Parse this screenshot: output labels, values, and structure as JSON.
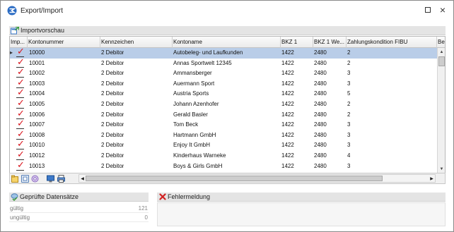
{
  "window": {
    "title": "Export/Import",
    "maximize_icon": "maximize-icon",
    "close_label": "×"
  },
  "preview": {
    "section_label": "Importvorschau",
    "columns": [
      "Imp...",
      "Kontonummer",
      "Kennzeichen",
      "Kontoname",
      "BKZ 1",
      "BKZ 1 We...",
      "Zahlungskondition FIBU",
      "Bele"
    ],
    "rows": [
      {
        "kontonummer": "10000",
        "kennzeichen": "2  Debitor",
        "kontoname": "Autobeleg- und Laufkunden",
        "bkz1": "1422",
        "bkz1we": "2480",
        "zahlung": "2",
        "selected": true
      },
      {
        "kontonummer": "10001",
        "kennzeichen": "2  Debitor",
        "kontoname": "Annas Sportwelt 12345",
        "bkz1": "1422",
        "bkz1we": "2480",
        "zahlung": "2",
        "selected": false
      },
      {
        "kontonummer": "10002",
        "kennzeichen": "2  Debitor",
        "kontoname": "Ammansberger",
        "bkz1": "1422",
        "bkz1we": "2480",
        "zahlung": "3",
        "selected": false
      },
      {
        "kontonummer": "10003",
        "kennzeichen": "2  Debitor",
        "kontoname": "Auermann Sport",
        "bkz1": "1422",
        "bkz1we": "2480",
        "zahlung": "3",
        "selected": false
      },
      {
        "kontonummer": "10004",
        "kennzeichen": "2  Debitor",
        "kontoname": "Austria Sports",
        "bkz1": "1422",
        "bkz1we": "2480",
        "zahlung": "5",
        "selected": false
      },
      {
        "kontonummer": "10005",
        "kennzeichen": "2  Debitor",
        "kontoname": "Johann Azenhofer",
        "bkz1": "1422",
        "bkz1we": "2480",
        "zahlung": "2",
        "selected": false
      },
      {
        "kontonummer": "10006",
        "kennzeichen": "2  Debitor",
        "kontoname": "Gerald Basler",
        "bkz1": "1422",
        "bkz1we": "2480",
        "zahlung": "2",
        "selected": false
      },
      {
        "kontonummer": "10007",
        "kennzeichen": "2  Debitor",
        "kontoname": "Tom Beck",
        "bkz1": "1422",
        "bkz1we": "2480",
        "zahlung": "3",
        "selected": false
      },
      {
        "kontonummer": "10008",
        "kennzeichen": "2  Debitor",
        "kontoname": "Hartmann GmbH",
        "bkz1": "1422",
        "bkz1we": "2480",
        "zahlung": "3",
        "selected": false
      },
      {
        "kontonummer": "10010",
        "kennzeichen": "2  Debitor",
        "kontoname": "Enjoy It GmbH",
        "bkz1": "1422",
        "bkz1we": "2480",
        "zahlung": "3",
        "selected": false
      },
      {
        "kontonummer": "10012",
        "kennzeichen": "2  Debitor",
        "kontoname": "Kinderhaus Warneke",
        "bkz1": "1422",
        "bkz1we": "2480",
        "zahlung": "4",
        "selected": false
      },
      {
        "kontonummer": "10013",
        "kennzeichen": "2  Debitor",
        "kontoname": "Boys & Girls GmbH",
        "bkz1": "1422",
        "bkz1we": "2480",
        "zahlung": "3",
        "selected": false
      }
    ],
    "toolbar_icons": [
      "import-icon",
      "export-icon",
      "settings-icon",
      "view-icon",
      "print-icon"
    ]
  },
  "stats": {
    "section_label": "Geprüfte Datensätze",
    "valid_label": "gültig",
    "valid_value": "121",
    "invalid_label": "ungültig",
    "invalid_value": "0"
  },
  "errors": {
    "section_label": "Fehlermeldung"
  },
  "colors": {
    "selected_row": "#b9cde8",
    "check_red": "#d9141c",
    "error_red": "#d22222"
  }
}
